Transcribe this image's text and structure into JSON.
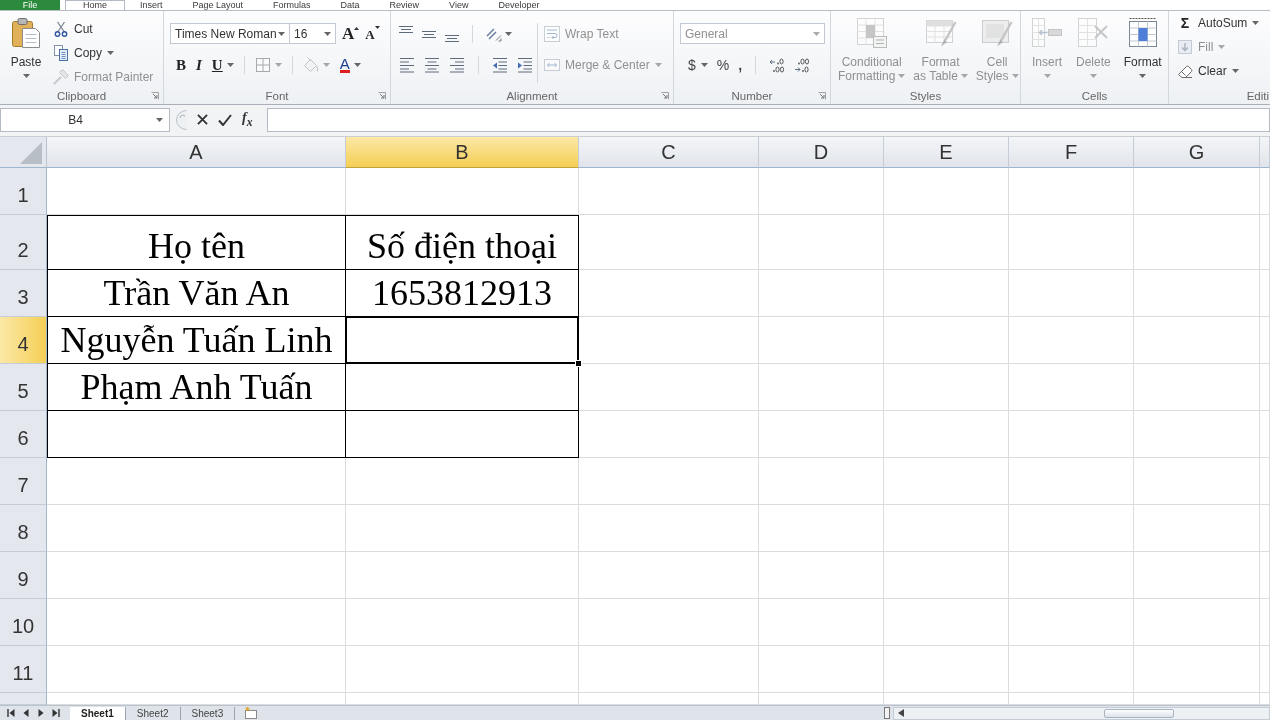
{
  "ribbon_tabs": [
    {
      "label": "File",
      "kind": "file",
      "selected": false
    },
    {
      "label": "Home",
      "kind": "tab",
      "selected": true
    },
    {
      "label": "Insert",
      "kind": "tab",
      "selected": false
    },
    {
      "label": "Page Layout",
      "kind": "tab",
      "selected": false
    },
    {
      "label": "Formulas",
      "kind": "tab",
      "selected": false
    },
    {
      "label": "Data",
      "kind": "tab",
      "selected": false
    },
    {
      "label": "Review",
      "kind": "tab",
      "selected": false
    },
    {
      "label": "View",
      "kind": "tab",
      "selected": false
    },
    {
      "label": "Developer",
      "kind": "tab",
      "selected": false
    }
  ],
  "clipboard": {
    "title": "Clipboard",
    "launcher": true,
    "paste": {
      "label": "Paste",
      "dropdown": true
    },
    "buttons": [
      {
        "kind": "cut",
        "label": "Cut",
        "disabled": false,
        "dropdown": false
      },
      {
        "kind": "copy",
        "label": "Copy",
        "disabled": false,
        "dropdown": true
      },
      {
        "kind": "format_painter",
        "label": "Format Painter",
        "disabled": true,
        "dropdown": false
      }
    ]
  },
  "font": {
    "title": "Font",
    "launcher": true,
    "font_name": "Times New Roman",
    "font_size": "16",
    "grow_font": "A",
    "shrink_font": "A",
    "buttons": [
      {
        "kind": "bold",
        "label": "B",
        "disabled": false,
        "dropdown": false
      },
      {
        "kind": "italic",
        "label": "I",
        "disabled": false,
        "dropdown": false
      },
      {
        "kind": "underline",
        "label": "U",
        "disabled": false,
        "dropdown": true
      },
      {
        "kind": "borders",
        "disabled": true,
        "dropdown": true
      },
      {
        "kind": "fill_color",
        "disabled": true,
        "dropdown": true
      },
      {
        "kind": "font_color",
        "label": "A",
        "disabled": false,
        "dropdown": true
      }
    ]
  },
  "alignment": {
    "title": "Alignment",
    "launcher": true,
    "wrap_text": {
      "label": "Wrap Text",
      "disabled": true
    },
    "merge_center": {
      "label": "Merge & Center",
      "disabled": true,
      "dropdown": true
    }
  },
  "number": {
    "title": "Number",
    "launcher": true,
    "format": {
      "value": "General",
      "disabled": true
    },
    "currency": "$",
    "percent": "%",
    "comma": ","
  },
  "styles": {
    "title": "Styles",
    "buttons": [
      {
        "kind": "conditional_formatting",
        "lines": [
          "Conditional",
          "Formatting"
        ],
        "disabled": true,
        "dropdown": true
      },
      {
        "kind": "format_as_table",
        "lines": [
          "Format",
          "as Table"
        ],
        "disabled": true,
        "dropdown": true
      },
      {
        "kind": "cell_styles",
        "lines": [
          "Cell",
          "Styles"
        ],
        "disabled": true,
        "dropdown": true
      }
    ]
  },
  "cells": {
    "title": "Cells",
    "buttons": [
      {
        "kind": "insert",
        "lines": [
          "Insert"
        ],
        "disabled": true,
        "dropdown": true
      },
      {
        "kind": "delete",
        "lines": [
          "Delete"
        ],
        "disabled": true,
        "dropdown": true
      },
      {
        "kind": "format",
        "lines": [
          "Format"
        ],
        "disabled": false,
        "dropdown": true
      }
    ]
  },
  "editing": {
    "title": "Editi",
    "buttons": [
      {
        "kind": "autosum",
        "symbol": "Σ",
        "label": "AutoSum",
        "disabled": false,
        "dropdown": true
      },
      {
        "kind": "fill",
        "label": "Fill",
        "disabled": true,
        "dropdown": true
      },
      {
        "kind": "clear",
        "label": "Clear",
        "disabled": false,
        "dropdown": true
      }
    ]
  },
  "formula_bar": {
    "name_box": "B4",
    "function_label": "f$_{x}$"
  },
  "columns": [
    {
      "label": "A",
      "selected": false
    },
    {
      "label": "B",
      "selected": true
    },
    {
      "label": "C",
      "selected": false
    },
    {
      "label": "D",
      "selected": false
    },
    {
      "label": "E",
      "selected": false
    },
    {
      "label": "F",
      "selected": false
    },
    {
      "label": "G",
      "selected": false
    }
  ],
  "rows": [
    {
      "label": "1",
      "selected": false,
      "bordered": false
    },
    {
      "label": "2",
      "selected": false,
      "bordered": true,
      "cells": [
        {
          "text": "Họ tên"
        },
        {
          "text": "Số điện thoại"
        }
      ]
    },
    {
      "label": "3",
      "selected": false,
      "bordered": true,
      "cells": [
        {
          "text": "Trần Văn An"
        },
        {
          "text": "1653812913"
        }
      ]
    },
    {
      "label": "4",
      "selected": true,
      "bordered": true,
      "cells": [
        {
          "text": "Nguyễn Tuấn Linh"
        }
      ]
    },
    {
      "label": "5",
      "selected": false,
      "bordered": true,
      "cells": [
        {
          "text": "Phạm Anh Tuấn"
        }
      ]
    },
    {
      "label": "6",
      "selected": false,
      "bordered": true
    },
    {
      "label": "7",
      "selected": false,
      "bordered": false
    },
    {
      "label": "8",
      "selected": false,
      "bordered": false
    },
    {
      "label": "9",
      "selected": false,
      "bordered": false
    },
    {
      "label": "10",
      "selected": false,
      "bordered": false
    },
    {
      "label": "11",
      "selected": false,
      "bordered": false
    }
  ],
  "sheet_tabs": [
    {
      "label": "Sheet1",
      "selected": true
    },
    {
      "label": "Sheet2",
      "selected": false
    },
    {
      "label": "Sheet3",
      "selected": false
    }
  ]
}
